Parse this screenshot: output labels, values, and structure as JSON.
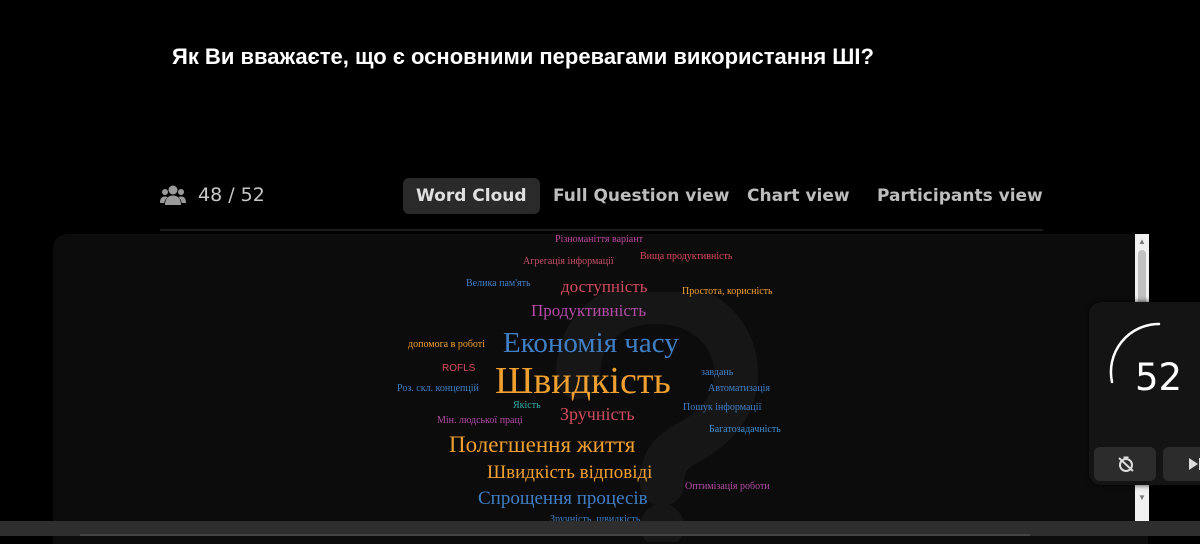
{
  "question": {
    "title": "Як Ви вважаєте, що є основними перевагами використання ШІ?"
  },
  "counter": {
    "text": "48 / 52",
    "icon": "users-icon"
  },
  "tabs": [
    {
      "label": "Word Cloud",
      "active": true
    },
    {
      "label": "Full Question view",
      "active": false
    },
    {
      "label": "Chart view",
      "active": false
    },
    {
      "label": "Participants view",
      "active": false
    }
  ],
  "word_cloud": [
    {
      "text": "Різноманіття варіант",
      "color": "#b9459e"
    },
    {
      "text": "Агрегація інформації",
      "color": "#c8506b"
    },
    {
      "text": "Вища продуктивність",
      "color": "#d6495f"
    },
    {
      "text": "Велика пам'ять",
      "color": "#3f7fc4"
    },
    {
      "text": "доступність",
      "color": "#d04b5f"
    },
    {
      "text": "Простота, корисність",
      "color": "#f0a030"
    },
    {
      "text": "Продуктивність",
      "color": "#b24aa6"
    },
    {
      "text": "допомога в роботі",
      "color": "#f0a030"
    },
    {
      "text": "Економія часу",
      "color": "#3f7fc4"
    },
    {
      "text": "ROFLS",
      "color": "#d04b5f"
    },
    {
      "text": "Швидкість",
      "color": "#f0a030"
    },
    {
      "text": "завдань",
      "color": "#3f7fc4"
    },
    {
      "text": "Роз. скл. концепцій",
      "color": "#3f7fc4"
    },
    {
      "text": "Автоматизація",
      "color": "#3f7fc4"
    },
    {
      "text": "Якість",
      "color": "#2fb0a8"
    },
    {
      "text": "Зручність",
      "color": "#d04b5f"
    },
    {
      "text": "Пошук інформації",
      "color": "#3f7fc4"
    },
    {
      "text": "Мін. людської праці",
      "color": "#b24aa6"
    },
    {
      "text": "Багатозадачність",
      "color": "#3f8fd0"
    },
    {
      "text": "Полегшення життя",
      "color": "#f0a030"
    },
    {
      "text": "Швидкість відповіді",
      "color": "#f0a030"
    },
    {
      "text": "Спрощення процесів",
      "color": "#3f7fc4"
    },
    {
      "text": "Оптимізація роботи",
      "color": "#b24aa6"
    },
    {
      "text": "Зручність, швидкість",
      "color": "#3f7fc4"
    }
  ],
  "widget": {
    "count": "52",
    "pause_icon": "timer-off-icon",
    "next_icon": "skip-next-icon"
  },
  "colors": {
    "background": "#000000",
    "panel": "#0c0c0c",
    "tab_active_bg": "#2a2a2a"
  }
}
